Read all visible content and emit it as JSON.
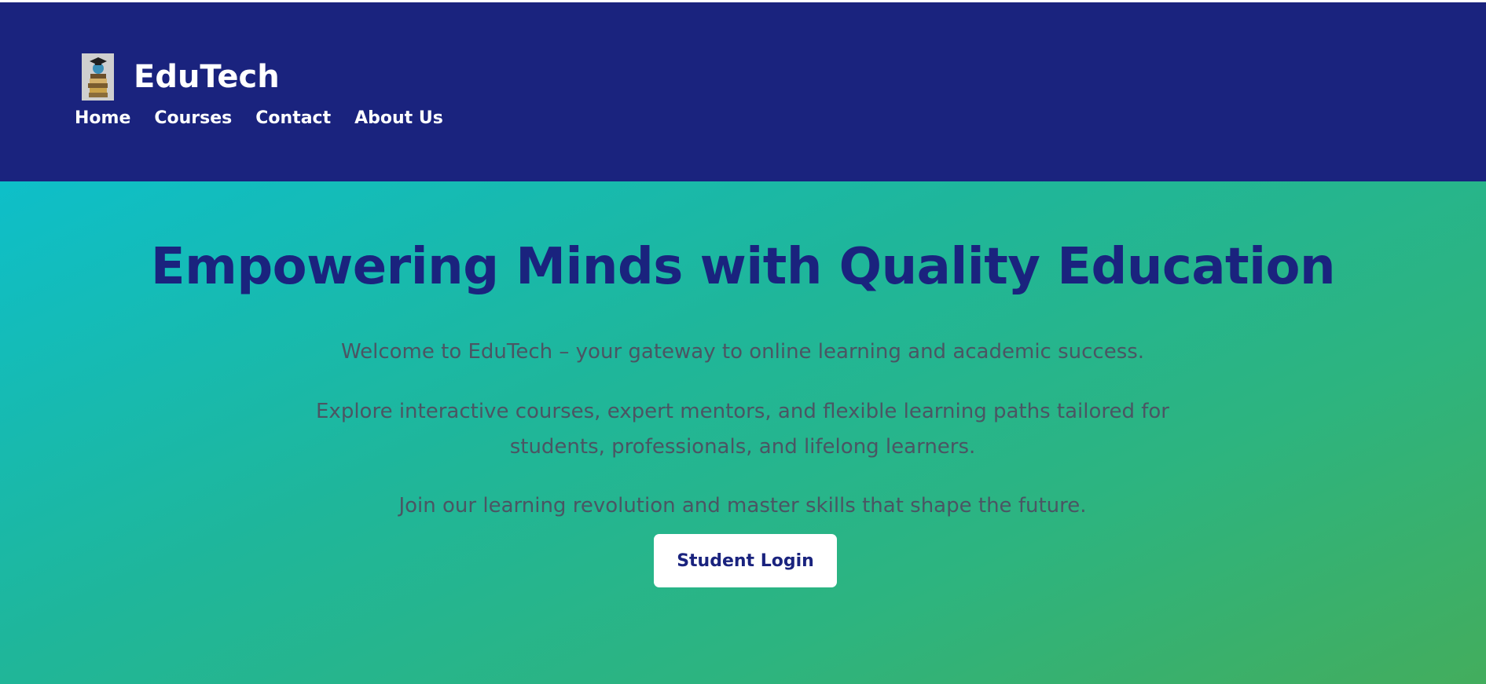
{
  "header": {
    "brand_name": "EduTech",
    "logo_icon": "graduation-books-icon",
    "nav": [
      {
        "label": "Home"
      },
      {
        "label": "Courses"
      },
      {
        "label": "Contact"
      },
      {
        "label": "About Us"
      }
    ],
    "background_color": "#1a237e"
  },
  "hero": {
    "title": "Empowering Minds with Quality Education",
    "paragraphs": [
      "Welcome to EduTech – your gateway to online learning and academic success.",
      "Explore interactive courses, expert mentors, and flexible learning paths tailored for students, professionals, and lifelong learners.",
      "Join our learning revolution and master skills that shape the future."
    ],
    "button_label": "Student Login",
    "gradient_colors": [
      "#0ebfc9",
      "#43ad5d"
    ],
    "title_color": "#1a237e"
  }
}
